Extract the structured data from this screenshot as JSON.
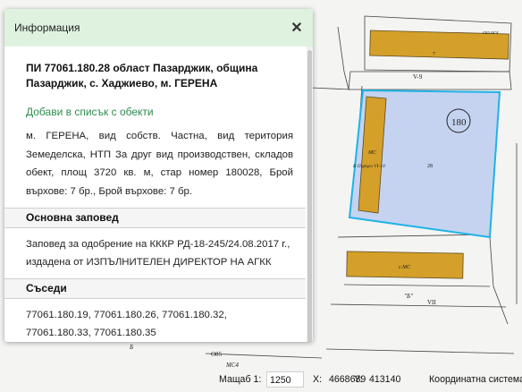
{
  "map": {
    "label_180": "180",
    "label_v9": "V-9",
    "label_7": "7",
    "label_selo": "сел.осл",
    "label_ms_left": "МС",
    "label_vpr": "В Парцел VI-10",
    "label_28": "28",
    "label_ms_lower": "с.МС",
    "label_b": "\"Б\"",
    "label_vii": "VII",
    "label_085": "О85",
    "label_ms4": "МС4",
    "label_6": "Б"
  },
  "panel": {
    "title": "Информация",
    "close_icon": "close-icon",
    "parcel_title": "ПИ 77061.180.28 област Пазарджик, община Пазарджик, с. Хаджиево, м. ГЕРЕНА",
    "add_link": "Добави в списък с обекти",
    "description": "м. ГЕРЕНА, вид собств. Частна, вид територия Земеделска, НТП За друг вид производствен, складов обект, площ 3720 кв. м, стар номер 180028, Брой върхове: 7 бр., Брой върхове: 7 бр.",
    "sections": [
      {
        "title": "Основна заповед",
        "body": "Заповед за одобрение на КККР РД-18-245/24.08.2017 г., издадена от ИЗПЪЛНИТЕЛЕН ДИРЕКТОР НА АГКК"
      },
      {
        "title": "Съседи",
        "body": "77061.180.19, 77061.180.26, 77061.180.32, 77061.180.33, 77061.180.35"
      }
    ]
  },
  "status": {
    "scale_label": "Мащаб 1:",
    "scale_value": "1250",
    "x_label": "X:",
    "x_value": "4668639",
    "y_label": "Y:",
    "y_value": "413140",
    "coord_label": "Координатна система:"
  },
  "colors": {
    "header_bg": "#dff2df",
    "link": "#2c8c4c",
    "parcel_fill": "#c5d3f0",
    "parcel_outline": "#1fb3e6",
    "building_fill": "#d4a02a"
  }
}
